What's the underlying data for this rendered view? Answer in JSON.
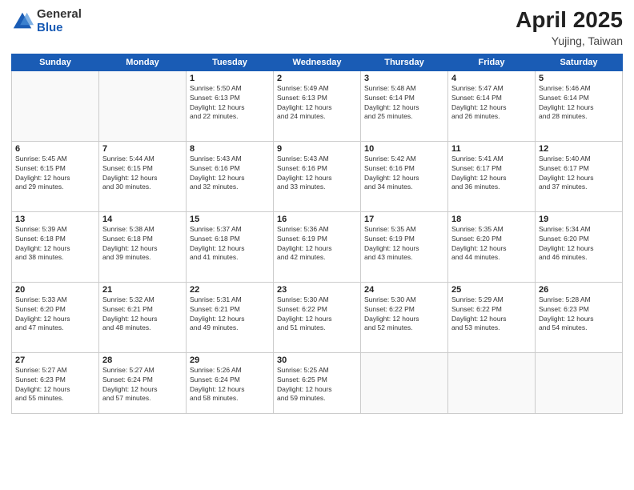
{
  "logo": {
    "general": "General",
    "blue": "Blue"
  },
  "title": {
    "month": "April 2025",
    "location": "Yujing, Taiwan"
  },
  "days_header": [
    "Sunday",
    "Monday",
    "Tuesday",
    "Wednesday",
    "Thursday",
    "Friday",
    "Saturday"
  ],
  "weeks": [
    [
      {
        "num": "",
        "info": ""
      },
      {
        "num": "",
        "info": ""
      },
      {
        "num": "1",
        "info": "Sunrise: 5:50 AM\nSunset: 6:13 PM\nDaylight: 12 hours\nand 22 minutes."
      },
      {
        "num": "2",
        "info": "Sunrise: 5:49 AM\nSunset: 6:13 PM\nDaylight: 12 hours\nand 24 minutes."
      },
      {
        "num": "3",
        "info": "Sunrise: 5:48 AM\nSunset: 6:14 PM\nDaylight: 12 hours\nand 25 minutes."
      },
      {
        "num": "4",
        "info": "Sunrise: 5:47 AM\nSunset: 6:14 PM\nDaylight: 12 hours\nand 26 minutes."
      },
      {
        "num": "5",
        "info": "Sunrise: 5:46 AM\nSunset: 6:14 PM\nDaylight: 12 hours\nand 28 minutes."
      }
    ],
    [
      {
        "num": "6",
        "info": "Sunrise: 5:45 AM\nSunset: 6:15 PM\nDaylight: 12 hours\nand 29 minutes."
      },
      {
        "num": "7",
        "info": "Sunrise: 5:44 AM\nSunset: 6:15 PM\nDaylight: 12 hours\nand 30 minutes."
      },
      {
        "num": "8",
        "info": "Sunrise: 5:43 AM\nSunset: 6:16 PM\nDaylight: 12 hours\nand 32 minutes."
      },
      {
        "num": "9",
        "info": "Sunrise: 5:43 AM\nSunset: 6:16 PM\nDaylight: 12 hours\nand 33 minutes."
      },
      {
        "num": "10",
        "info": "Sunrise: 5:42 AM\nSunset: 6:16 PM\nDaylight: 12 hours\nand 34 minutes."
      },
      {
        "num": "11",
        "info": "Sunrise: 5:41 AM\nSunset: 6:17 PM\nDaylight: 12 hours\nand 36 minutes."
      },
      {
        "num": "12",
        "info": "Sunrise: 5:40 AM\nSunset: 6:17 PM\nDaylight: 12 hours\nand 37 minutes."
      }
    ],
    [
      {
        "num": "13",
        "info": "Sunrise: 5:39 AM\nSunset: 6:18 PM\nDaylight: 12 hours\nand 38 minutes."
      },
      {
        "num": "14",
        "info": "Sunrise: 5:38 AM\nSunset: 6:18 PM\nDaylight: 12 hours\nand 39 minutes."
      },
      {
        "num": "15",
        "info": "Sunrise: 5:37 AM\nSunset: 6:18 PM\nDaylight: 12 hours\nand 41 minutes."
      },
      {
        "num": "16",
        "info": "Sunrise: 5:36 AM\nSunset: 6:19 PM\nDaylight: 12 hours\nand 42 minutes."
      },
      {
        "num": "17",
        "info": "Sunrise: 5:35 AM\nSunset: 6:19 PM\nDaylight: 12 hours\nand 43 minutes."
      },
      {
        "num": "18",
        "info": "Sunrise: 5:35 AM\nSunset: 6:20 PM\nDaylight: 12 hours\nand 44 minutes."
      },
      {
        "num": "19",
        "info": "Sunrise: 5:34 AM\nSunset: 6:20 PM\nDaylight: 12 hours\nand 46 minutes."
      }
    ],
    [
      {
        "num": "20",
        "info": "Sunrise: 5:33 AM\nSunset: 6:20 PM\nDaylight: 12 hours\nand 47 minutes."
      },
      {
        "num": "21",
        "info": "Sunrise: 5:32 AM\nSunset: 6:21 PM\nDaylight: 12 hours\nand 48 minutes."
      },
      {
        "num": "22",
        "info": "Sunrise: 5:31 AM\nSunset: 6:21 PM\nDaylight: 12 hours\nand 49 minutes."
      },
      {
        "num": "23",
        "info": "Sunrise: 5:30 AM\nSunset: 6:22 PM\nDaylight: 12 hours\nand 51 minutes."
      },
      {
        "num": "24",
        "info": "Sunrise: 5:30 AM\nSunset: 6:22 PM\nDaylight: 12 hours\nand 52 minutes."
      },
      {
        "num": "25",
        "info": "Sunrise: 5:29 AM\nSunset: 6:22 PM\nDaylight: 12 hours\nand 53 minutes."
      },
      {
        "num": "26",
        "info": "Sunrise: 5:28 AM\nSunset: 6:23 PM\nDaylight: 12 hours\nand 54 minutes."
      }
    ],
    [
      {
        "num": "27",
        "info": "Sunrise: 5:27 AM\nSunset: 6:23 PM\nDaylight: 12 hours\nand 55 minutes."
      },
      {
        "num": "28",
        "info": "Sunrise: 5:27 AM\nSunset: 6:24 PM\nDaylight: 12 hours\nand 57 minutes."
      },
      {
        "num": "29",
        "info": "Sunrise: 5:26 AM\nSunset: 6:24 PM\nDaylight: 12 hours\nand 58 minutes."
      },
      {
        "num": "30",
        "info": "Sunrise: 5:25 AM\nSunset: 6:25 PM\nDaylight: 12 hours\nand 59 minutes."
      },
      {
        "num": "",
        "info": ""
      },
      {
        "num": "",
        "info": ""
      },
      {
        "num": "",
        "info": ""
      }
    ]
  ]
}
